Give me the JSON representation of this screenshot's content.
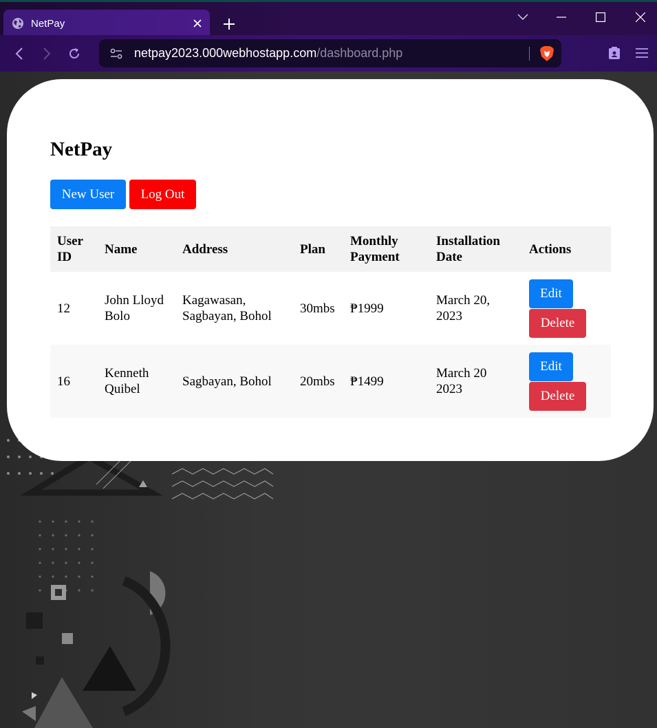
{
  "browser": {
    "tab_title": "NetPay",
    "url_host": "netpay2023.000webhostapp.com",
    "url_path": "/dashboard.php",
    "icons": [
      "globe-icon",
      "close-icon",
      "plus-icon",
      "chevron-down-icon",
      "minimize-icon",
      "maximize-icon",
      "window-close-icon",
      "back-icon",
      "forward-icon",
      "reload-icon",
      "site-settings-icon",
      "brave-shield-icon",
      "clipboard-icon",
      "menu-icon"
    ]
  },
  "page": {
    "title": "NetPay",
    "buttons": {
      "new_user": "New User",
      "log_out": "Log Out"
    },
    "colors": {
      "primary": "#0a7cf5",
      "danger": "#dc3545",
      "logout": "#fb0000"
    }
  },
  "table": {
    "headers": {
      "user_id": "User ID",
      "name": "Name",
      "address": "Address",
      "plan": "Plan",
      "monthly_payment": "Monthly Payment",
      "installation_date": "Installation Date",
      "actions": "Actions"
    },
    "rows": [
      {
        "user_id": "12",
        "name": "John Lloyd Bolo",
        "address": "Kagawasan, Sagbayan, Bohol",
        "plan": "30mbs",
        "monthly_payment": "₱1999",
        "installation_date": "March 20, 2023",
        "edit": "Edit",
        "delete": "Delete"
      },
      {
        "user_id": "16",
        "name": "Kenneth Quibel",
        "address": "Sagbayan, Bohol",
        "plan": "20mbs",
        "monthly_payment": "₱1499",
        "installation_date": "March 20 2023",
        "edit": "Edit",
        "delete": "Delete"
      }
    ]
  }
}
